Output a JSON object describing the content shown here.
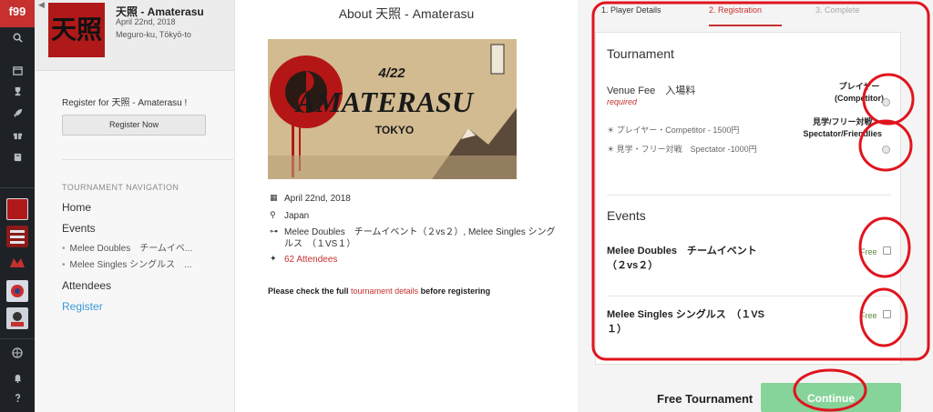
{
  "rail": {
    "logo": "f99",
    "icons": [
      "search-icon",
      "calendar-icon",
      "trophy-icon",
      "rocket-icon",
      "gift-icon",
      "book-icon",
      "globe-icon",
      "bell-icon",
      "question-icon"
    ]
  },
  "sidebar": {
    "event_title": "天照 - Amaterasu",
    "event_date": "April 22nd, 2018",
    "event_location": "Meguro-ku, Tōkyō-to",
    "avatar_text": "天照",
    "register_prompt": "Register for 天照 - Amaterasu !",
    "register_button": "Register Now",
    "nav_title": "TOURNAMENT NAVIGATION",
    "nav": {
      "home": "Home",
      "events": "Events",
      "event_1": "Melee Doubles　チームイベ...",
      "event_2": "Melee Singles シングルス　...",
      "attendees": "Attendees",
      "register": "Register"
    }
  },
  "center": {
    "about_title": "About 天照 - Amaterasu",
    "banner": {
      "date": "4/22",
      "title": "AMATERASU",
      "city": "TOKYO"
    },
    "date": "April 22nd, 2018",
    "country": "Japan",
    "events_line": "Melee Doubles　チームイベント（２vs２）, Melee Singles シングルス　（１VS１）",
    "attendees": "62 Attendees",
    "note_before": "Please check the full ",
    "note_link": "tournament details",
    "note_after": " before registering"
  },
  "steps": {
    "step1": "1. Player Details",
    "step2": "2. Registration",
    "step3": "3. Complete"
  },
  "tournament": {
    "title": "Tournament",
    "fee_label": "Venue Fee　入場料",
    "required": "required",
    "option_1": "☀ プレイヤー・Competitor - 1500円",
    "option_2": "☀ 見学・フリー対戦　Spectator -1000円",
    "choice_1_a": "プレイヤー",
    "choice_1_b": "(Competitor)",
    "choice_2_a": "見学/フリー対戦",
    "choice_2_b": "Spectator/Friendlies"
  },
  "events": {
    "title": "Events",
    "event_1_a": "Melee Doubles　チームイベント",
    "event_1_b": "（２vs２）",
    "event_2_a": "Melee Singles シングルス　（１VS",
    "event_2_b": "１）",
    "free": "Free"
  },
  "footer": {
    "free_tournament": "Free Tournament",
    "continue": "Continue"
  },
  "colors": {
    "accent": "#c6302e",
    "link": "#3a9ad9",
    "continue": "#86d49a",
    "annotation": "#e0141e"
  }
}
